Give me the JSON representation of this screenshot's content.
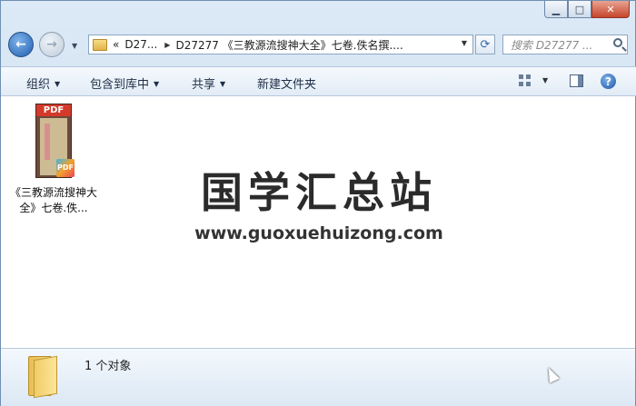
{
  "window": {
    "buttons": {
      "minimize": "▁",
      "maximize": "□",
      "close": "✕"
    }
  },
  "nav": {
    "address": {
      "overflow": "«",
      "segment1": "D27...",
      "segment2": "D27277 《三教源流搜神大全》七卷.佚名撰...."
    },
    "search_placeholder": "搜索 D27277 ..."
  },
  "toolbar": {
    "organize": "组织",
    "include_in_library": "包含到库中",
    "share": "共享",
    "new_folder": "新建文件夹"
  },
  "content": {
    "files": [
      {
        "name": "《三教源流搜神大全》七卷.佚...",
        "icon_label": "PDF",
        "badge": "PDF"
      }
    ],
    "watermark": {
      "title": "国学汇总站",
      "url": "www.guoxuehuizong.com"
    }
  },
  "status": {
    "count": "1 个对象"
  }
}
